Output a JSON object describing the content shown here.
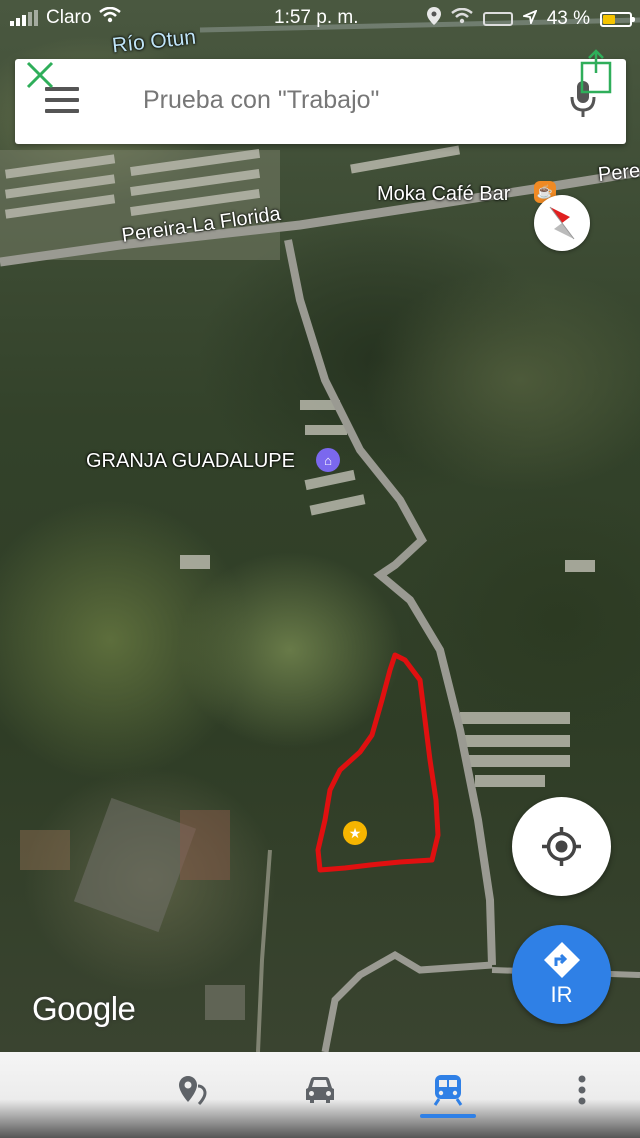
{
  "status_bar": {
    "carrier": "Claro",
    "time": "1:57 p. m.",
    "battery": "43 %"
  },
  "search": {
    "placeholder": "Prueba con \"Trabajo\""
  },
  "map": {
    "labels": {
      "river": "Río Otun",
      "road": "Pereira-La Florida",
      "cafe": "Moka Café Bar",
      "cafe_partial": "Pere",
      "farm": "GRANJA GUADALUPE"
    },
    "attribution": "Google"
  },
  "buttons": {
    "go": "IR"
  },
  "bottom_nav": {
    "tabs": [
      {
        "icon": "explore-icon"
      },
      {
        "icon": "car-icon"
      },
      {
        "icon": "transit-icon",
        "active": true
      },
      {
        "icon": "more-icon"
      }
    ]
  },
  "colors": {
    "accent": "#2f80e6",
    "boundary": "#e01010",
    "cafe_pin": "#f08a24",
    "place_pin": "#7b68ee",
    "star_pin": "#f6b500"
  }
}
